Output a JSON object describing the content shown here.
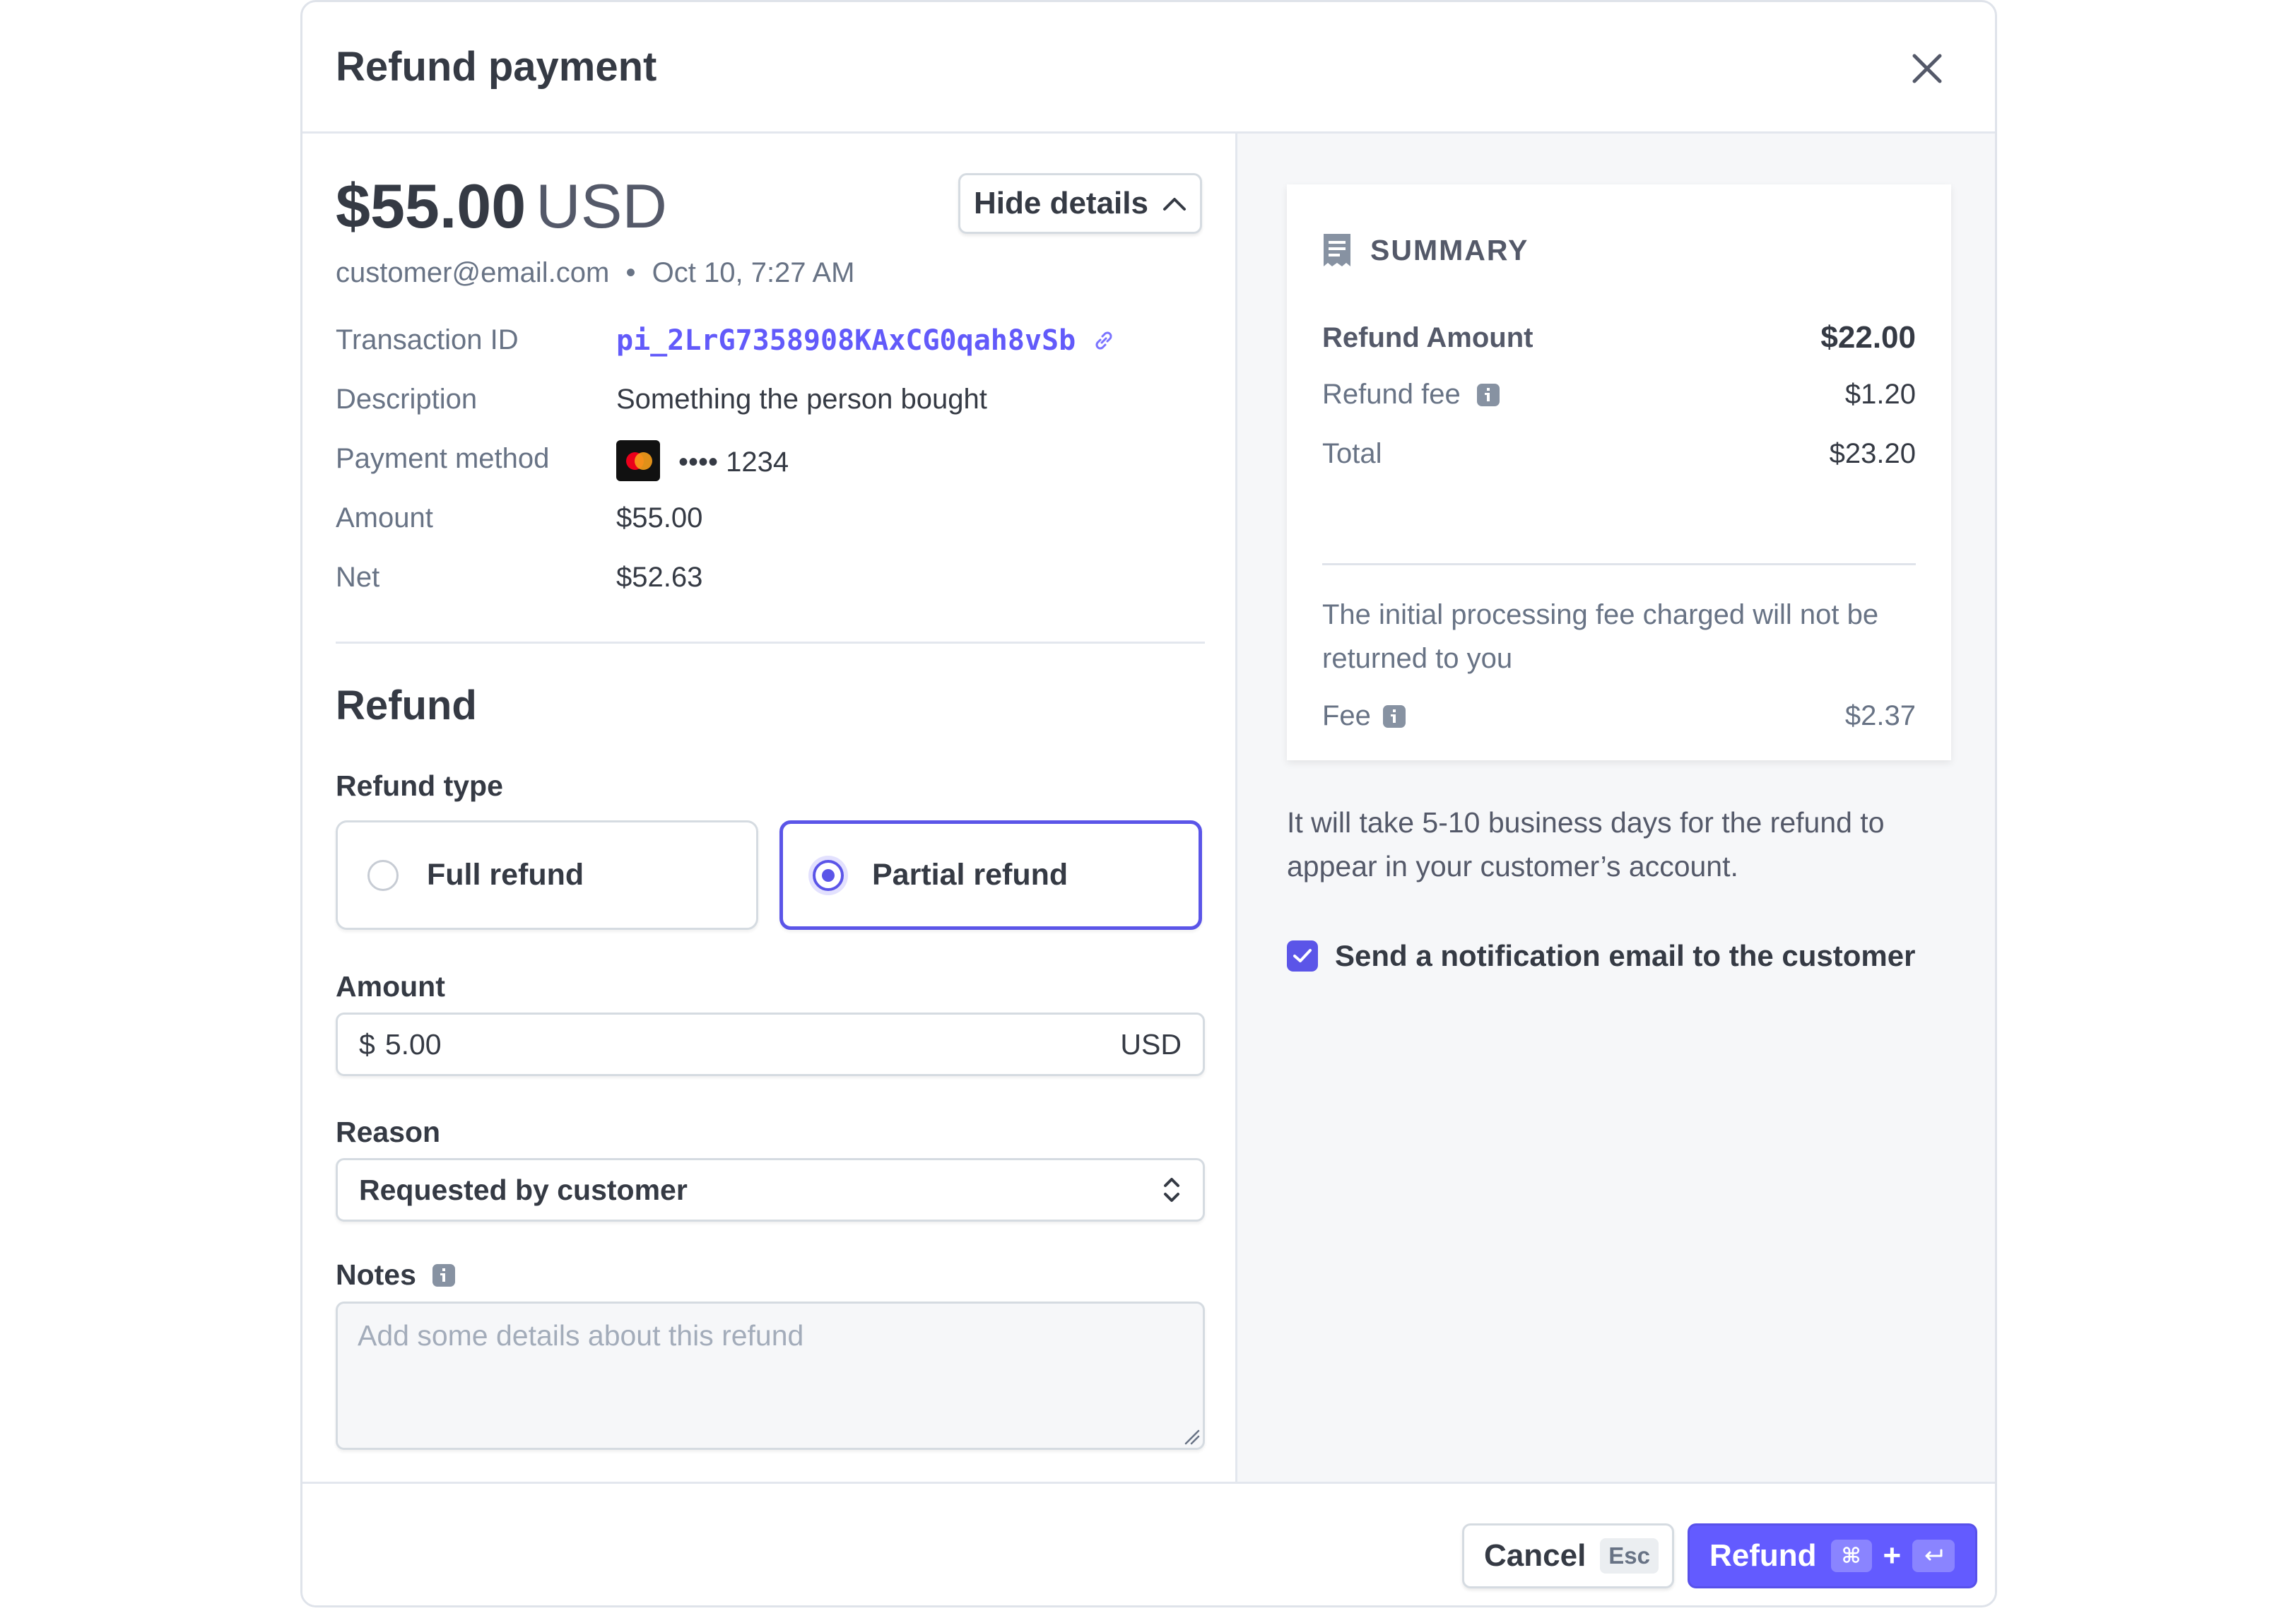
{
  "header": {
    "title": "Refund payment"
  },
  "payment": {
    "amount": "$55.00",
    "currency": "USD",
    "email": "customer@email.com",
    "separator": "•",
    "date": "Oct 10, 7:27 AM",
    "hide_details_label": "Hide details"
  },
  "details": [
    {
      "label": "Transaction ID",
      "value": "pi_2LrG7358908KAxCG0qah8vSb"
    },
    {
      "label": "Description",
      "value": "Something the person bought"
    },
    {
      "label": "Payment method",
      "value": "•••• 1234"
    },
    {
      "label": "Amount",
      "value": "$55.00"
    },
    {
      "label": "Net",
      "value": "$52.63"
    }
  ],
  "refund": {
    "heading": "Refund",
    "type_label": "Refund type",
    "options": [
      {
        "label": "Full refund",
        "selected": false
      },
      {
        "label": "Partial refund",
        "selected": true
      }
    ],
    "amount_label": "Amount",
    "amount_prefix": "$",
    "amount_value": "5.00",
    "amount_suffix": "USD",
    "reason_label": "Reason",
    "reason_value": "Requested by customer",
    "notes_label": "Notes",
    "notes_placeholder": "Add some details about this refund"
  },
  "summary": {
    "title": "SUMMARY",
    "rows": [
      {
        "label": "Refund Amount",
        "value": "$22.00"
      },
      {
        "label": "Refund fee",
        "value": "$1.20"
      },
      {
        "label": "Total",
        "value": "$23.20"
      }
    ],
    "note": "The initial processing fee charged will not be returned to you",
    "fee_label": "Fee",
    "fee_value": "$2.37"
  },
  "info_text": "It will take 5-10 business days for the refund to appear in your customer’s account.",
  "notification": {
    "label": "Send a notification email to the customer",
    "checked": true
  },
  "footer": {
    "cancel_label": "Cancel",
    "cancel_shortcut": "Esc",
    "refund_label": "Refund",
    "refund_shortcut_mod": "⌘",
    "refund_shortcut_plus": "+"
  },
  "colors": {
    "accent": "#635bff",
    "text": "#353a44",
    "muted": "#687385",
    "panel_bg": "#f6f7f9"
  }
}
